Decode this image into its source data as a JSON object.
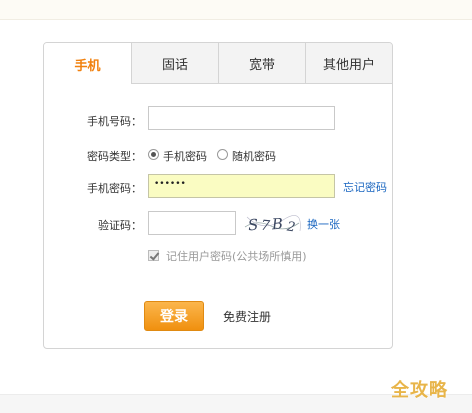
{
  "tabs": [
    {
      "label": "手机",
      "active": true
    },
    {
      "label": "固话",
      "active": false
    },
    {
      "label": "宽带",
      "active": false
    },
    {
      "label": "其他用户",
      "active": false
    }
  ],
  "form": {
    "phone_label": "手机号码：",
    "phone_value": "",
    "pwd_type_label": "密码类型：",
    "pwd_type_options": [
      "手机密码",
      "随机密码"
    ],
    "pwd_type_selected": "手机密码",
    "pwd_label": "手机密码：",
    "pwd_value": "••••••",
    "forgot_link": "忘记密码",
    "captcha_label": "验证码：",
    "captcha_value": "",
    "captcha_text": "S7B2",
    "captcha_refresh": "换一张",
    "remember_label": "记住用户密码(公共场所慎用)",
    "remember_checked": true
  },
  "actions": {
    "login": "登录",
    "register": "免费注册"
  },
  "watermark": "全攻略",
  "colors": {
    "active_tab": "#f1810f",
    "button": "#f0900f",
    "link": "#1a66c0",
    "password_field_bg": "#fafcc2"
  }
}
